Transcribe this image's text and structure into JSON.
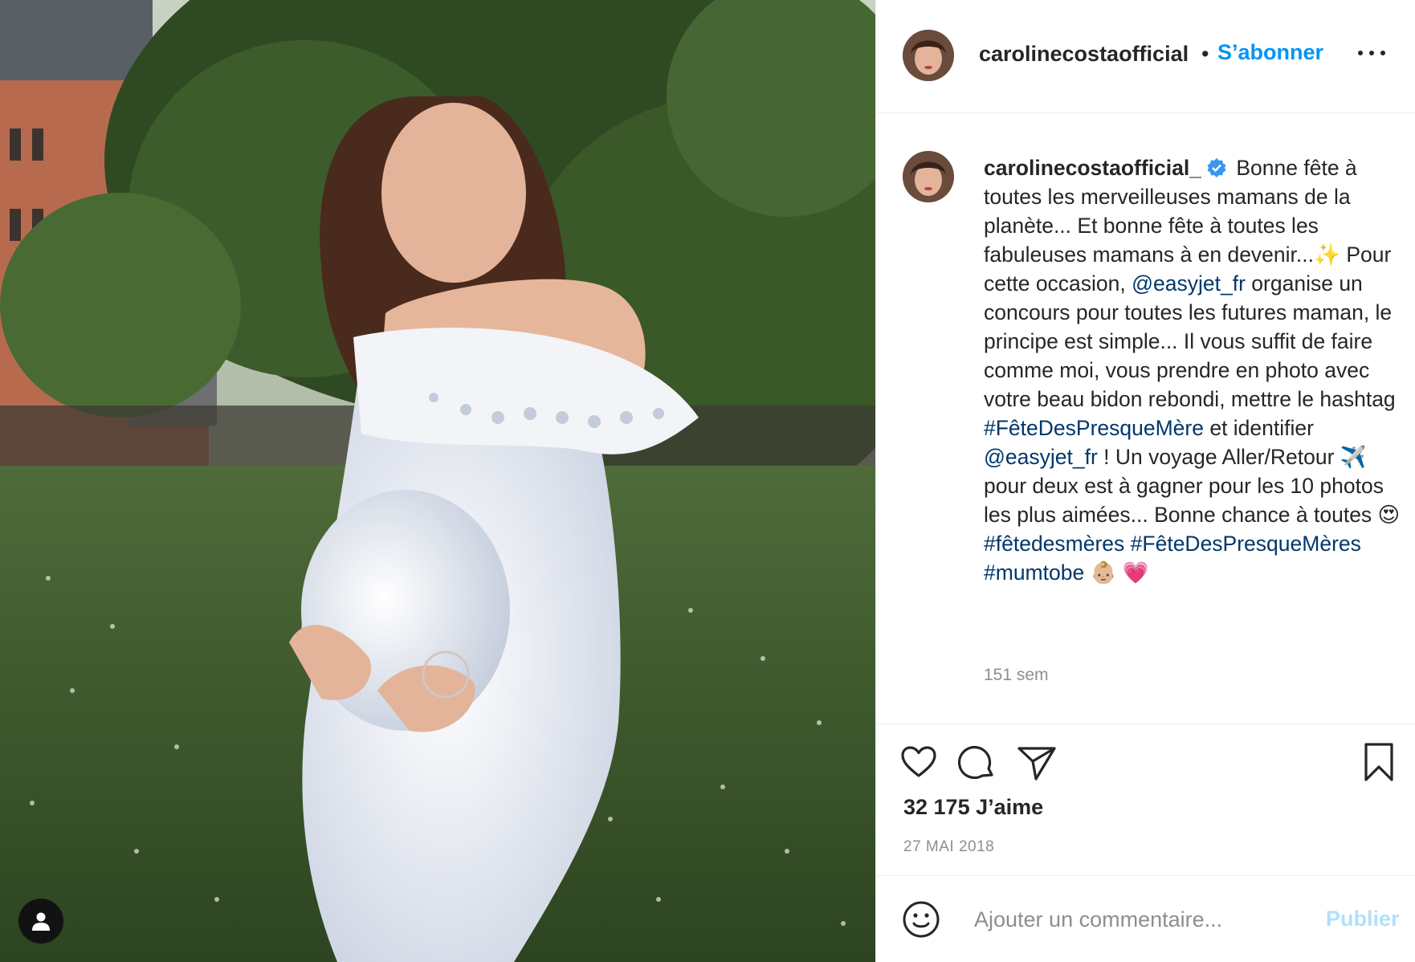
{
  "header": {
    "username": "carolinecostaofficial",
    "separator": "•",
    "follow_label": "S’abonner",
    "more_icon": "more-horizontal-icon"
  },
  "caption": {
    "username": "carolinecostaofficial_",
    "verified_icon": "verified-badge-icon",
    "segments": [
      {
        "type": "text",
        "value": " Bonne fête à toutes les merveilleuses mamans de la planète... Et bonne fête à toutes les fabuleuses mamans à en devenir...✨ Pour cette occasion, "
      },
      {
        "type": "link",
        "value": "@easyjet_fr"
      },
      {
        "type": "text",
        "value": " organise un concours pour toutes les futures maman, le principe est simple... Il vous suffit de faire comme moi, vous prendre en photo avec votre beau bidon rebondi, mettre le hashtag "
      },
      {
        "type": "link",
        "value": "#FêteDesPresqueMère"
      },
      {
        "type": "text",
        "value": " et identifier "
      },
      {
        "type": "link",
        "value": "@easyjet_fr"
      },
      {
        "type": "text",
        "value": " ! Un voyage Aller/Retour ✈️ pour deux est à gagner pour les 10 photos les plus aimées... Bonne chance à toutes 😍 "
      },
      {
        "type": "link",
        "value": "#fêtedesmères"
      },
      {
        "type": "text",
        "value": " "
      },
      {
        "type": "link",
        "value": "#FêteDesPresqueMères"
      },
      {
        "type": "text",
        "value": " "
      },
      {
        "type": "link",
        "value": "#mumtobe"
      },
      {
        "type": "text",
        "value": " 👶🏼 💗"
      }
    ],
    "time_ago": "151 sem"
  },
  "actions": {
    "like_icon": "heart-icon",
    "comment_icon": "comment-icon",
    "share_icon": "paper-plane-icon",
    "save_icon": "bookmark-icon",
    "likes_text": "32 175 J’aime",
    "date": "27 MAI 2018"
  },
  "comment": {
    "emoji_icon": "smiley-icon",
    "placeholder": "Ajouter un commentaire...",
    "publish_label": "Publier"
  },
  "photo": {
    "tag_icon": "user-tag-icon"
  },
  "colors": {
    "accent": "#0095f6",
    "link": "#00376b",
    "muted": "#8e8e8e",
    "publish_disabled": "#b2dffc"
  }
}
